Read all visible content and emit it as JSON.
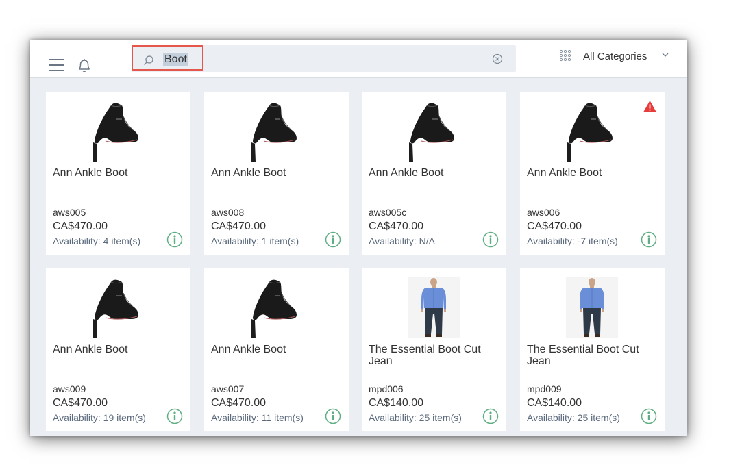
{
  "search": {
    "value": "Boot"
  },
  "category": {
    "label": "All Categories"
  },
  "icons": {
    "menu": "hamburger-menu-icon",
    "notifications": "bell-icon",
    "search": "search-icon",
    "clear": "clear-icon",
    "categories": "grid-dots-icon",
    "dropdown": "chevron-down-icon",
    "info": "info-icon",
    "warning": "warning-icon"
  },
  "colors": {
    "accent_green": "#5fae82",
    "warning_red": "#e63c3c",
    "focus_red": "#e4574a"
  },
  "products": [
    {
      "title": "Ann Ankle Boot",
      "sku": "aws005",
      "price": "CA$470.00",
      "availability": "Availability: 4 item(s)",
      "image": "boot",
      "warning": false
    },
    {
      "title": "Ann Ankle Boot",
      "sku": "aws008",
      "price": "CA$470.00",
      "availability": "Availability: 1 item(s)",
      "image": "boot",
      "warning": false
    },
    {
      "title": "Ann Ankle Boot",
      "sku": "aws005c",
      "price": "CA$470.00",
      "availability": "Availability: N/A",
      "image": "boot",
      "warning": false
    },
    {
      "title": "Ann Ankle Boot",
      "sku": "aws006",
      "price": "CA$470.00",
      "availability": "Availability: -7 item(s)",
      "image": "boot",
      "warning": true
    },
    {
      "title": "Ann Ankle Boot",
      "sku": "aws009",
      "price": "CA$470.00",
      "availability": "Availability: 19 item(s)",
      "image": "boot",
      "warning": false
    },
    {
      "title": "Ann Ankle Boot",
      "sku": "aws007",
      "price": "CA$470.00",
      "availability": "Availability: 11 item(s)",
      "image": "boot",
      "warning": false
    },
    {
      "title": "The Essential Boot Cut Jean",
      "sku": "mpd006",
      "price": "CA$140.00",
      "availability": "Availability: 25 item(s)",
      "image": "jeans",
      "warning": false
    },
    {
      "title": "The Essential Boot Cut Jean",
      "sku": "mpd009",
      "price": "CA$140.00",
      "availability": "Availability: 25 item(s)",
      "image": "jeans",
      "warning": false
    }
  ]
}
